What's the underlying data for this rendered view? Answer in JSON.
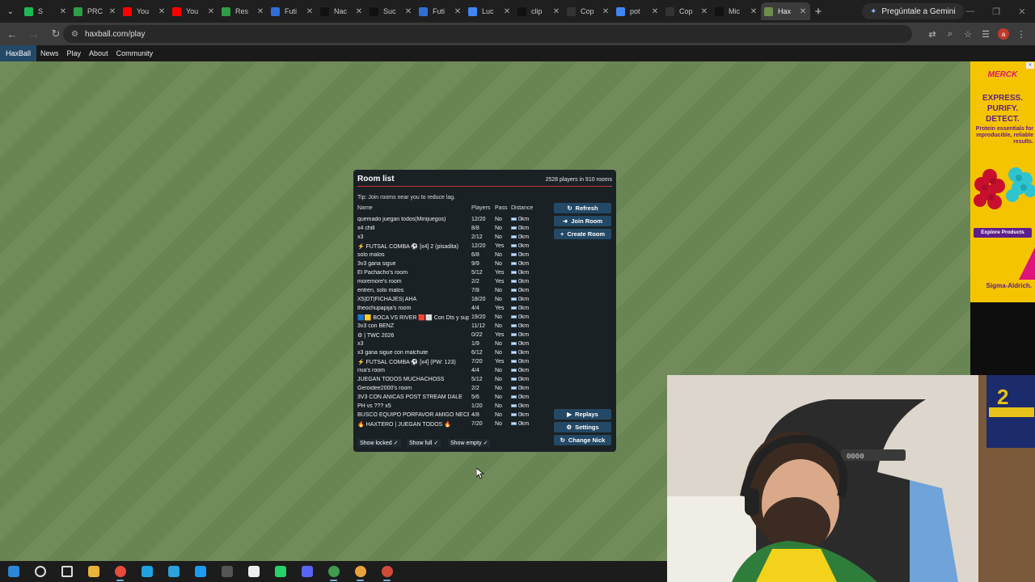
{
  "browser": {
    "tabs": [
      {
        "label": "S",
        "color": "#1db954"
      },
      {
        "label": "PRC",
        "color": "#2e9d47"
      },
      {
        "label": "You",
        "color": "#ff0000"
      },
      {
        "label": "You",
        "color": "#ff0000"
      },
      {
        "label": "Res",
        "color": "#2e9d47"
      },
      {
        "label": "Futi",
        "color": "#2f6fd6"
      },
      {
        "label": "Nac",
        "color": "#111111"
      },
      {
        "label": "Suc",
        "color": "#111111"
      },
      {
        "label": "Futi",
        "color": "#2f6fd6"
      },
      {
        "label": "Luc",
        "color": "#4285f4"
      },
      {
        "label": "clip",
        "color": "#111111"
      },
      {
        "label": "Cop",
        "color": "#333333"
      },
      {
        "label": "pot",
        "color": "#4285f4"
      },
      {
        "label": "Cop",
        "color": "#333333"
      },
      {
        "label": "Mic",
        "color": "#111111"
      },
      {
        "label": "Hax",
        "color": "#6c8f4e",
        "active": true
      }
    ],
    "new_tab_symbol": "+",
    "gemini_label": "Pregúntale a Gemini",
    "url": "haxball.com/play"
  },
  "site_nav": {
    "brand": "HaxBall",
    "links": [
      "News",
      "Play",
      "About",
      "Community"
    ]
  },
  "room_list": {
    "title": "Room list",
    "player_count": "2528 players in 910 rooms",
    "tip": "Tip: Join rooms near you to reduce lag.",
    "columns": {
      "name": "Name",
      "players": "Players",
      "pass": "Pass",
      "distance": "Distance"
    },
    "rooms": [
      {
        "name": "quemado juegan todos(Minijuegos)",
        "players": "12/20",
        "pass": "No",
        "distance": "0km"
      },
      {
        "name": "x4 chill",
        "players": "8/8",
        "pass": "No",
        "distance": "0km"
      },
      {
        "name": "x3",
        "players": "2/12",
        "pass": "No",
        "distance": "0km"
      },
      {
        "name": "⚡ FUTSAL COMBA ⚽ [x4] 2 (pisadita)",
        "players": "12/20",
        "pass": "Yes",
        "distance": "0km"
      },
      {
        "name": "solo malos",
        "players": "6/8",
        "pass": "No",
        "distance": "0km"
      },
      {
        "name": "3v3 gana sigue",
        "players": "9/9",
        "pass": "No",
        "distance": "0km"
      },
      {
        "name": "El Pachacho's room",
        "players": "5/12",
        "pass": "Yes",
        "distance": "0km"
      },
      {
        "name": "moremore's room",
        "players": "2/2",
        "pass": "Yes",
        "distance": "0km"
      },
      {
        "name": "entren, solo malos",
        "players": "7/8",
        "pass": "No",
        "distance": "0km"
      },
      {
        "name": "X5|DT|FICHAJES| AHA",
        "players": "18/20",
        "pass": "No",
        "distance": "0km"
      },
      {
        "name": "theochupapija's room",
        "players": "4/4",
        "pass": "Yes",
        "distance": "0km"
      },
      {
        "name": "🟦🟨 BOCA VS RIVER 🟥⬜ Con Dts y supl",
        "players": "19/20",
        "pass": "No",
        "distance": "0km"
      },
      {
        "name": "3v3 con BENZ",
        "players": "11/12",
        "pass": "No",
        "distance": "0km"
      },
      {
        "name": "⚙ | TWC 2026",
        "players": "0/22",
        "pass": "Yes",
        "distance": "0km"
      },
      {
        "name": "x3",
        "players": "1/9",
        "pass": "No",
        "distance": "0km"
      },
      {
        "name": "x3 gana sigue con malchute",
        "players": "6/12",
        "pass": "No",
        "distance": "0km"
      },
      {
        "name": "⚡ FUTSAL COMBA ⚽ [x4] (PW: 123)",
        "players": "7/20",
        "pass": "Yes",
        "distance": "0km"
      },
      {
        "name": "riva's room",
        "players": "4/4",
        "pass": "No",
        "distance": "0km"
      },
      {
        "name": "JUEGAN TODOS MUCHACHOSS",
        "players": "5/12",
        "pass": "No",
        "distance": "0km"
      },
      {
        "name": "Geroidee2000's room",
        "players": "2/2",
        "pass": "No",
        "distance": "0km"
      },
      {
        "name": "3V3 CON ANICAS POST STREAM DALE",
        "players": "5/6",
        "pass": "No",
        "distance": "0km"
      },
      {
        "name": "PH vs ??? x5",
        "players": "1/20",
        "pass": "No",
        "distance": "0km"
      },
      {
        "name": "BUSCO EQUIPO PORFAVOR AMIGO NECEC",
        "players": "4/8",
        "pass": "No",
        "distance": "0km"
      },
      {
        "name": "🔥 HAXTERO | JUEGAN TODOS 🔥",
        "players": "7/20",
        "pass": "No",
        "distance": "0km"
      }
    ],
    "buttons": {
      "refresh": "Refresh",
      "join": "Join Room",
      "create": "Create Room",
      "replays": "Replays",
      "settings": "Settings",
      "change_nick": "Change Nick"
    },
    "toggles": {
      "show_locked": "Show locked ✓",
      "show_full": "Show full ✓",
      "show_empty": "Show empty ✓"
    }
  },
  "ad": {
    "brand": "MERCK",
    "headline": [
      "EXPRESS.",
      "PURIFY.",
      "DETECT."
    ],
    "subtext": "Protein essentials for reproducible, reliable results.",
    "cta": "Explore Products",
    "footer": "Sigma-Aldrich."
  },
  "webcam": {
    "jersey_number": "2",
    "chair_label": "0000"
  },
  "taskbar": {
    "icons": [
      "windows-start",
      "search",
      "task-view",
      "file-explorer",
      "chrome",
      "edge",
      "telegram",
      "twitter",
      "obs",
      "capcut",
      "whatsapp",
      "discord",
      "chrome-profile-2",
      "chrome-profile-3",
      "chrome-profile-4"
    ]
  }
}
